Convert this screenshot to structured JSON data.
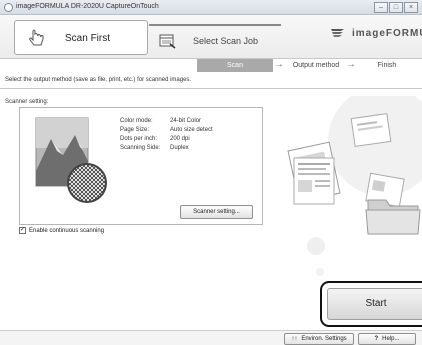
{
  "window": {
    "title": "imageFORMULA DR-2020U CaptureOnTouch",
    "controls": [
      "–",
      "□",
      "×"
    ]
  },
  "tabs": {
    "scan_first": "Scan First",
    "select_scan_job": "Select Scan Job"
  },
  "brand": "imageFORMUL",
  "steps": {
    "scan": "Scan",
    "output": "Output method",
    "finish": "Finish",
    "arrow": "→"
  },
  "instruction": "Select the output method (save as file, print, etc.) for scanned images.",
  "scanner_setting": {
    "caption": "Scanner setting:",
    "rows": [
      {
        "key": "Color mode:",
        "value": "24-bit Color"
      },
      {
        "key": "Page Size:",
        "value": "Auto size detect"
      },
      {
        "key": "Dots per inch:",
        "value": "200 dpi"
      },
      {
        "key": "Scanning Side:",
        "value": "Duplex"
      }
    ],
    "button": "Scanner setting..."
  },
  "continuous": {
    "label": "Enable continuous scanning",
    "checked": true,
    "mark": "✓"
  },
  "start_label": "Start",
  "bottom": {
    "env": "Environ. Settings",
    "help": "Help...",
    "env_icon": "↑↑",
    "help_icon": "?"
  },
  "colors": {
    "active_step": "#a9a9a9",
    "accent": "#111111"
  },
  "icons": [
    "hand-pointer-icon",
    "scan-job-icon",
    "logo-wings-icon",
    "checkbox-icon",
    "settings-icon",
    "help-icon"
  ]
}
